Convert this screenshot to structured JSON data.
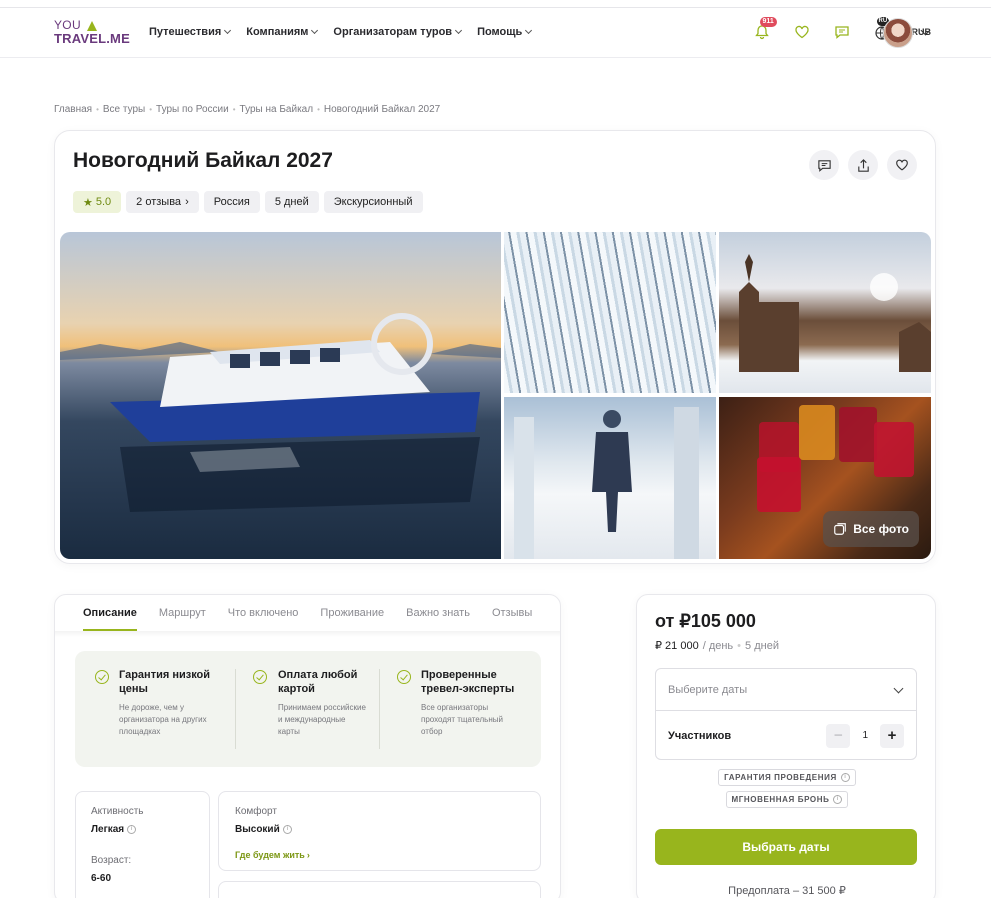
{
  "header": {
    "logo_top": "YOU",
    "logo_bottom": "TRAVEL.ME",
    "nav": [
      {
        "label": "Путешествия"
      },
      {
        "label": "Компаниям"
      },
      {
        "label": "Организаторам туров"
      },
      {
        "label": "Помощь"
      }
    ],
    "notifications_count": "911",
    "language": "RU",
    "currency": "RUB",
    "icons": [
      "bell-icon",
      "heart-icon",
      "chat-icon",
      "globe-icon"
    ]
  },
  "breadcrumb": [
    "Главная",
    "Все туры",
    "Туры по России",
    "Туры на Байкал",
    "Новогодний Байкал 2027"
  ],
  "tour": {
    "title": "Новогодний Байкал 2027",
    "rating": "5.0",
    "reviews": "2 отзыва",
    "country": "Россия",
    "duration": "5 дней",
    "type": "Экскурсионный",
    "all_photos": "Все фото"
  },
  "tabs": [
    "Описание",
    "Маршрут",
    "Что включено",
    "Проживание",
    "Важно знать",
    "Отзывы"
  ],
  "guarantees": [
    {
      "title": "Гарантия низкой цены",
      "desc": "Не дороже, чем у организатора на других площадках"
    },
    {
      "title": "Оплата любой картой",
      "desc": "Принимаем российские и международные карты"
    },
    {
      "title": "Проверенные тревел-эксперты",
      "desc": "Все организаторы проходят тщательный отбор"
    }
  ],
  "info": {
    "activity_label": "Активность",
    "activity_value": "Легкая",
    "age_label": "Возраст:",
    "age_value": "6-60",
    "comfort_label": "Комфорт",
    "comfort_value": "Высокий",
    "stay_link": "Где будем жить"
  },
  "booking": {
    "price": "от ₽105 000",
    "per_day": "₽ 21 000",
    "per_day_unit": "/ день",
    "days": "5 дней",
    "dates_placeholder": "Выберите даты",
    "participants_label": "Участников",
    "participants_value": "1",
    "pill_guarantee": "ГАРАНТИЯ ПРОВЕДЕНИЯ",
    "pill_instant": "МГНОВЕННАЯ БРОНЬ",
    "cta": "Выбрать даты",
    "prepay": "Предоплата – 31 500 ₽"
  },
  "colors": {
    "accent": "#98b51d",
    "brand": "#6a3a7d",
    "badge": "#e04b5d"
  }
}
